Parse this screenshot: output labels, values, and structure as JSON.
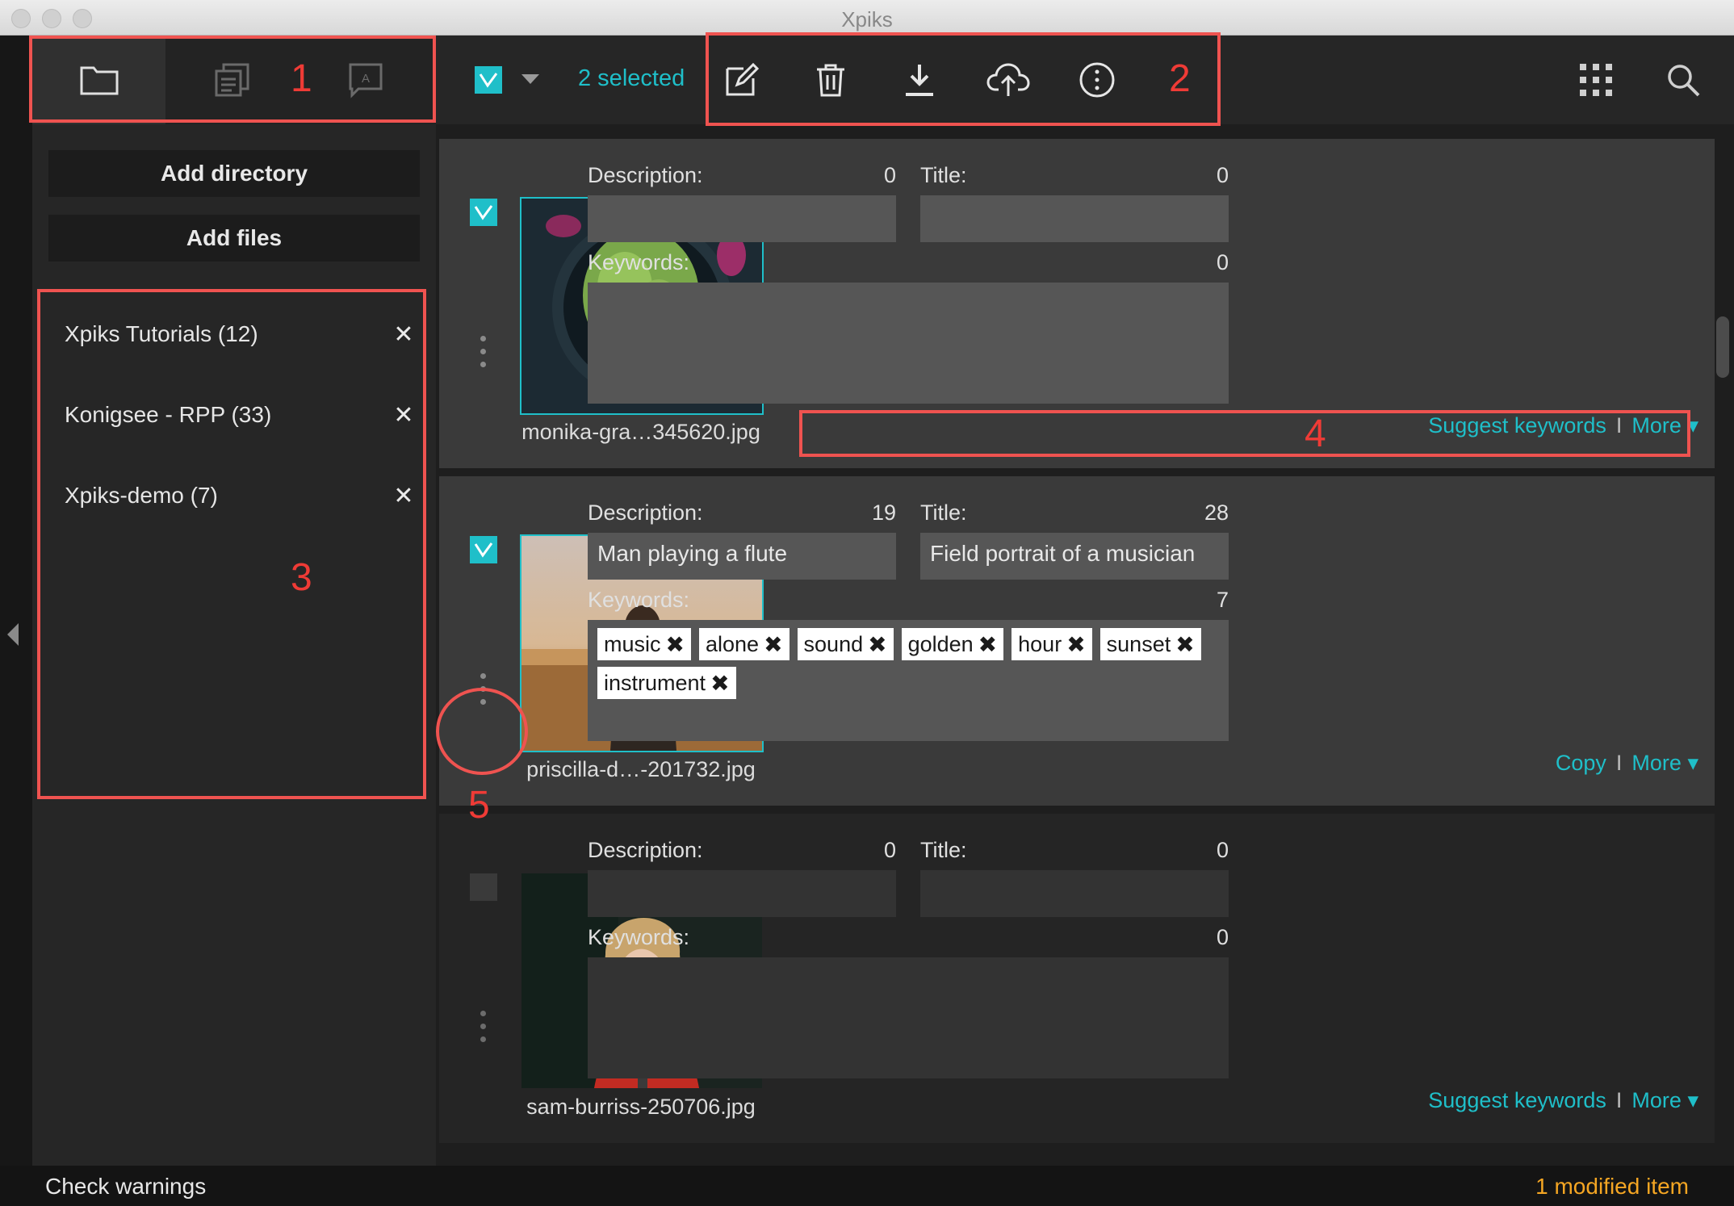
{
  "window": {
    "title": "Xpiks"
  },
  "sidebar": {
    "tabs": [
      {
        "name": "folder-tab",
        "icon": "folder-icon"
      },
      {
        "name": "files-tab",
        "icon": "files-icon"
      },
      {
        "name": "spelling-tab",
        "icon": "message-a-icon"
      }
    ],
    "add_directory_label": "Add directory",
    "add_files_label": "Add files",
    "directories": [
      {
        "label": "Xpiks Tutorials (12)"
      },
      {
        "label": "Konigsee - RPP (33)"
      },
      {
        "label": "Xpiks-demo (7)"
      }
    ]
  },
  "toolbar": {
    "selected_text": "2 selected",
    "actions": [
      "edit-icon",
      "trash-icon",
      "download-icon",
      "upload-cloud-icon",
      "more-vertical-icon"
    ],
    "right": [
      "grid-icon",
      "search-icon"
    ]
  },
  "artworks": [
    {
      "checked": true,
      "filename": "monika-gra…345620.jpg",
      "description_label": "Description:",
      "description_count": "0",
      "description": "",
      "title_label": "Title:",
      "title_count": "0",
      "title": "",
      "keywords_label": "Keywords:",
      "keywords_count": "0",
      "keywords": [],
      "link_primary": "Suggest keywords",
      "link_more": "More ▾"
    },
    {
      "checked": true,
      "filename": "priscilla-d…-201732.jpg",
      "description_label": "Description:",
      "description_count": "19",
      "description": "Man playing a flute",
      "title_label": "Title:",
      "title_count": "28",
      "title": "Field portrait of a musician",
      "keywords_label": "Keywords:",
      "keywords_count": "7",
      "keywords": [
        "music",
        "alone",
        "sound",
        "golden",
        "hour",
        "sunset",
        "instrument"
      ],
      "link_primary": "Copy",
      "link_more": "More ▾"
    },
    {
      "checked": false,
      "filename": "sam-burriss-250706.jpg",
      "description_label": "Description:",
      "description_count": "0",
      "description": "",
      "title_label": "Title:",
      "title_count": "0",
      "title": "",
      "keywords_label": "Keywords:",
      "keywords_count": "0",
      "keywords": [],
      "link_primary": "Suggest keywords",
      "link_more": "More ▾"
    }
  ],
  "status": {
    "left": "Check warnings",
    "right": "1 modified item"
  },
  "annotations": [
    "1",
    "2",
    "3",
    "4",
    "5"
  ],
  "colors": {
    "accent": "#1fbfc9",
    "annotation": "#ef5350",
    "modified": "#f5a623"
  }
}
